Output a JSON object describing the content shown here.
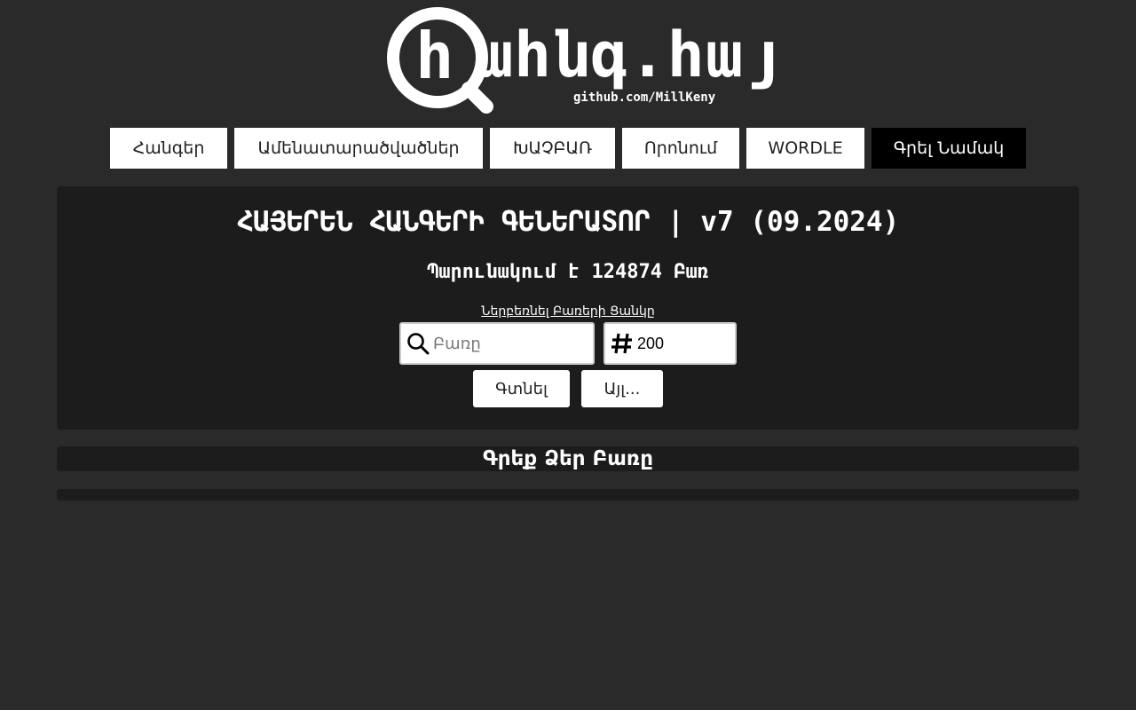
{
  "logo": {
    "text": "ահնգ.հայ",
    "subtitle": "github.com/MillKeny",
    "icon": "magnifier-icon"
  },
  "nav": {
    "items": [
      {
        "label": "Հանգեր",
        "active": false
      },
      {
        "label": "Ամենատարածվածներ",
        "active": false
      },
      {
        "label": "ԽԱՉԲԱՌ",
        "active": false
      },
      {
        "label": "Որոնում",
        "active": false
      },
      {
        "label": "WORDLE",
        "active": false
      },
      {
        "label": "Գրել Նամակ",
        "active": true
      }
    ]
  },
  "generator": {
    "title": "ՀԱՅԵՐԵՆ ՀԱՆԳԵՐԻ ԳԵՆԵՐԱՏՈՐ | v7 (09.2024)",
    "count_line": "Պարունակում է 124874 Բառ",
    "import_link": "Ներբեռնել Բառերի Ցանկը",
    "search": {
      "placeholder": "Բառը",
      "value": "",
      "icon": "search-icon"
    },
    "quantity": {
      "value": "200",
      "icon": "hash-icon"
    },
    "find_label": "Գտնել",
    "other_label": "Այլ..."
  },
  "word_prompt": "Գրեք Ձեր Բառը",
  "colors": {
    "background": "#2a2a2a",
    "panel": "#1c1c1c",
    "button": "#ffffff",
    "active_button": "#000000"
  }
}
